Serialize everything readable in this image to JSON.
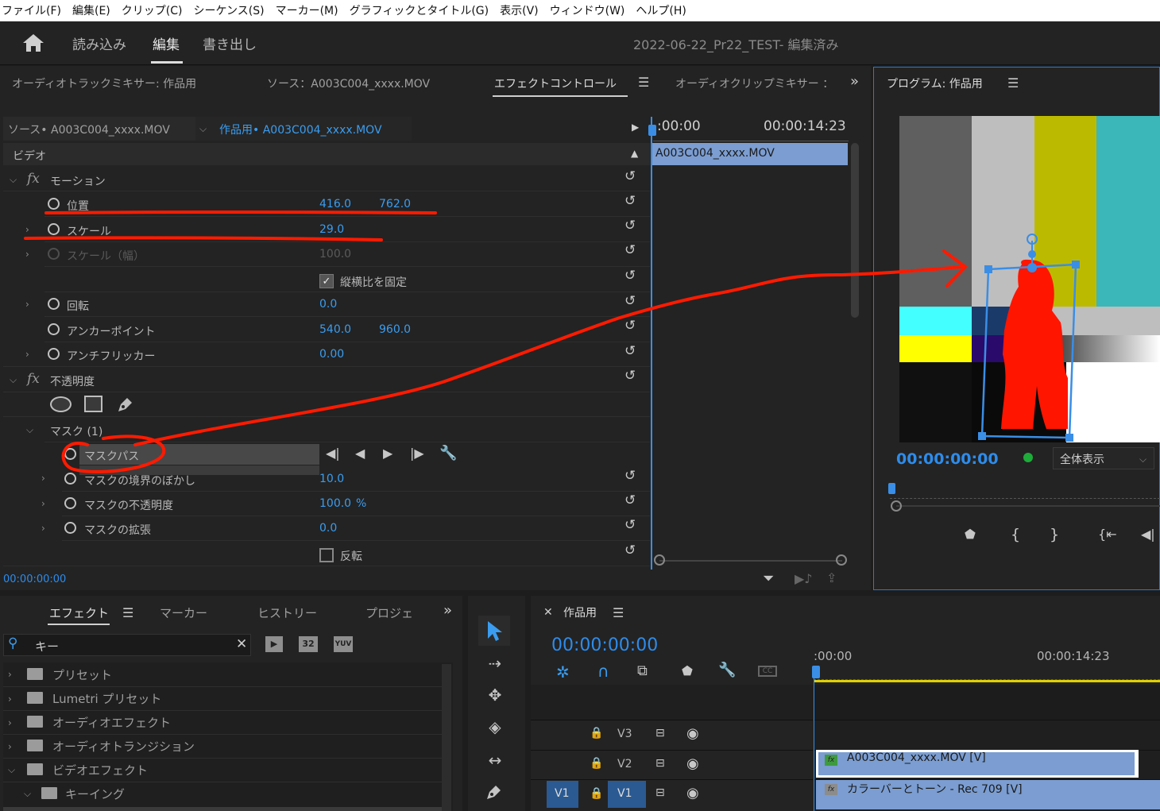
{
  "menu": [
    "ファイル(F)",
    "編集(E)",
    "クリップ(C)",
    "シーケンス(S)",
    "マーカー(M)",
    "グラフィックとタイトル(G)",
    "表示(V)",
    "ウィンドウ(W)",
    "ヘルプ(H)"
  ],
  "workspace": {
    "import": "読み込み",
    "edit": "編集",
    "export": "書き出し",
    "project_title": "2022-06-22_Pr22_TEST",
    "saved_status": "- 編集済み"
  },
  "top_tabs": {
    "audio_mixer": "オーディオトラックミキサー: 作品用",
    "source": "ソース：A003C004_xxxx.MOV",
    "effect_controls": "エフェクトコントロール",
    "audio_clip_mixer": "オーディオクリップミキサー ：",
    "overflow": "»"
  },
  "ec": {
    "source_clip": "ソース• A003C004_xxxx.MOV",
    "seq_clip": "作品用• A003C004_xxxx.MOV",
    "tl_start": ":00:00",
    "tl_end": "00:00:14:23",
    "clip_bar": "A003C004_xxxx.MOV",
    "video_header": "ビデオ",
    "motion": "モーション",
    "position": "位置",
    "pos_x": "416.0",
    "pos_y": "762.0",
    "scale": "スケール",
    "scale_v": "29.0",
    "scale_w": "スケール（幅）",
    "scale_w_v": "100.0",
    "uniform": "縦横比を固定",
    "rotation": "回転",
    "rot_v": "0.0",
    "anchor": "アンカーポイント",
    "anc_x": "540.0",
    "anc_y": "960.0",
    "flicker": "アンチフリッカー",
    "flicker_v": "0.00",
    "opacity": "不透明度",
    "mask": "マスク (1)",
    "mask_path": "マスクパス",
    "feather": "マスクの境界のぼかし",
    "feather_v": "10.0",
    "mask_opacity": "マスクの不透明度",
    "mask_opacity_v": "100.0",
    "mask_opacity_unit": "%",
    "expansion": "マスクの拡張",
    "expansion_v": "0.0",
    "invert": "反転",
    "timecode": "00:00:00:00"
  },
  "program": {
    "title": "プログラム: 作品用",
    "timecode": "00:00:00:00",
    "fit": "全体表示"
  },
  "effects": {
    "tabs": [
      "エフェクト",
      "マーカー",
      "ヒストリー",
      "プロジェ"
    ],
    "search": "キー",
    "items": [
      "プリセット",
      "Lumetri プリセット",
      "オーディオエフェクト",
      "オーディオトランジション",
      "ビデオエフェクト",
      "キーイング"
    ]
  },
  "timeline": {
    "title": "作品用",
    "timecode": "00:00:00:00",
    "ruler_start": ":00:00",
    "ruler_end": "00:00:14:23",
    "tracks": [
      "V3",
      "V2",
      "V1"
    ],
    "src_patch": "V1",
    "clip_v2": "A003C004_xxxx.MOV [V]",
    "clip_v1": "カラーバーとトーン - Rec 709 [V]"
  },
  "colors": {
    "accent": "#2d8ceb",
    "annotation": "#ff1a00",
    "clip": "#7b9dd1"
  }
}
